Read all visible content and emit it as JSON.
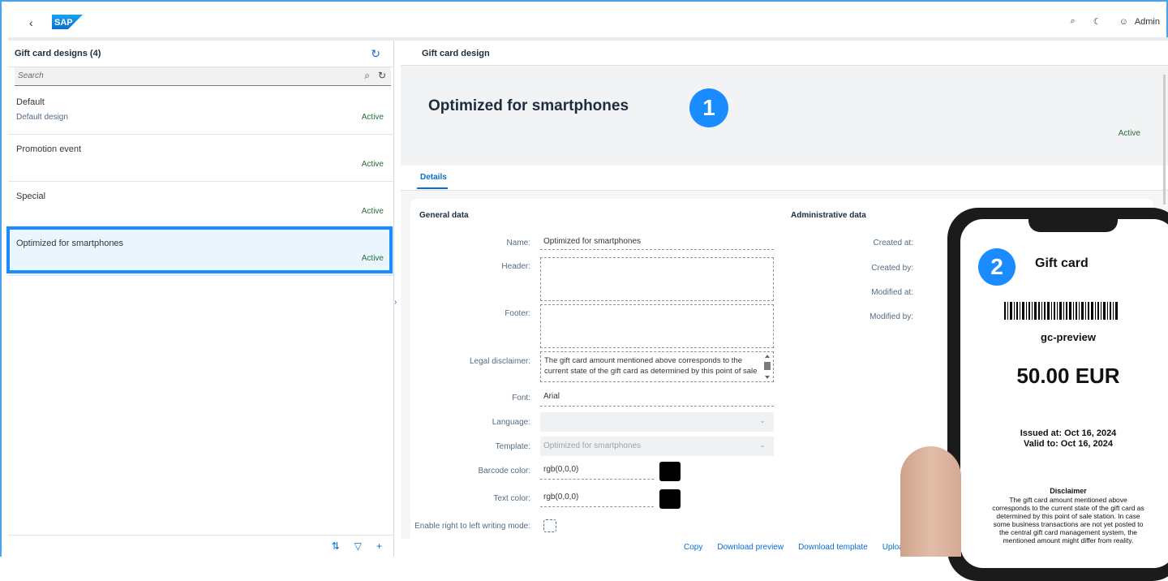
{
  "shell": {
    "logo_text": "SAP",
    "user_label": "Admin"
  },
  "list": {
    "title": "Gift card designs (4)",
    "search_placeholder": "Search",
    "items": [
      {
        "name": "Default",
        "description": "Default design",
        "status": "Active"
      },
      {
        "name": "Promotion event",
        "description": "",
        "status": "Active"
      },
      {
        "name": "Special",
        "description": "",
        "status": "Active"
      },
      {
        "name": "Optimized for smartphones",
        "description": "",
        "status": "Active"
      }
    ]
  },
  "detail": {
    "header_title": "Gift card design",
    "object_title": "Optimized for smartphones",
    "object_status": "Active",
    "badge_1": "1",
    "tab_details": "Details",
    "general_data": "General data",
    "administrative_data": "Administrative data",
    "labels": {
      "name": "Name:",
      "header": "Header:",
      "footer": "Footer:",
      "legal": "Legal disclaimer:",
      "font": "Font:",
      "language": "Language:",
      "template": "Template:",
      "barcode_color": "Barcode color:",
      "text_color": "Text color:",
      "rtl": "Enable right to left writing mode:",
      "created_at": "Created at:",
      "created_by": "Created by:",
      "modified_at": "Modified at:",
      "modified_by": "Modified by:"
    },
    "values": {
      "name": "Optimized for smartphones",
      "legal": "The gift card amount mentioned above corresponds to the current state of the gift card as determined by this point of sale",
      "font": "Arial",
      "language": "",
      "template": "Optimized for smartphones",
      "barcode_color": "rgb(0,0,0)",
      "text_color": "rgb(0,0,0)"
    },
    "footer_actions": [
      "Copy",
      "Download preview",
      "Download template",
      "Upload"
    ]
  },
  "preview": {
    "badge_2": "2",
    "title": "Gift card",
    "code": "gc-preview",
    "amount": "50.00 EUR",
    "issued": "Issued at: Oct 16, 2024",
    "valid": "Valid to: Oct 16, 2024",
    "disclaimer_title": "Disclaimer",
    "disclaimer_text": "The gift card amount mentioned above corresponds to the current state of the gift card as determined by this point of sale station. In case some business transactions are not yet posted to the central gift card management system, the mentioned amount might differ from reality."
  },
  "colors": {
    "accent": "#0a6ed1",
    "highlight": "#1a8cff",
    "positive": "#256f3a"
  }
}
